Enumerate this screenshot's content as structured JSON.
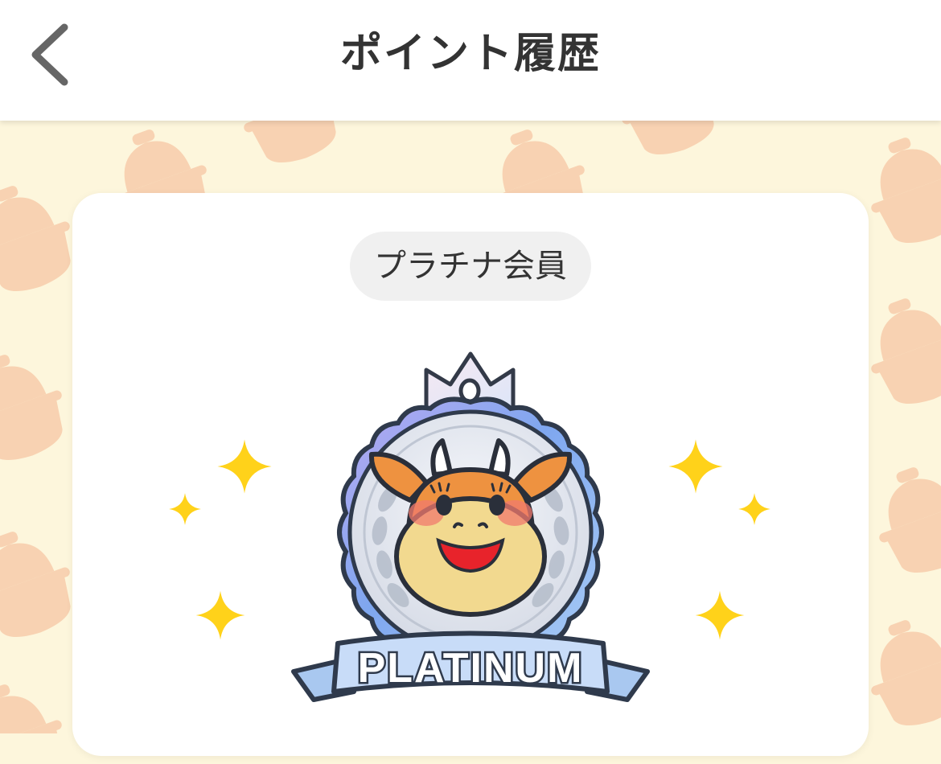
{
  "header": {
    "title": "ポイント履歴",
    "back_icon": "chevron-left-icon"
  },
  "membership": {
    "rank_label": "プラチナ会員",
    "emblem_text": "PLATINUM"
  },
  "colors": {
    "background": "#fdf6dc",
    "pattern": "#f7ccaa",
    "card": "#ffffff",
    "pill": "#f0f0f0",
    "sparkle": "#ffd21a",
    "mascot_face": "#ee9240",
    "ribbon": "#c8dcf8"
  }
}
